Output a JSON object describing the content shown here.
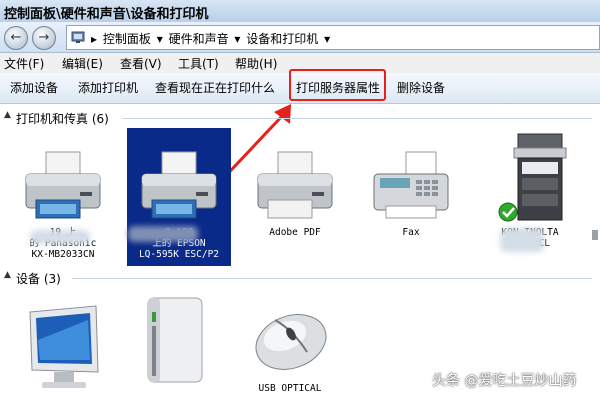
{
  "window": {
    "title": "控制面板\\硬件和声音\\设备和打印机"
  },
  "address": {
    "crumbs": [
      "控制面板",
      "硬件和声音",
      "设备和打印机"
    ]
  },
  "menu": {
    "items": [
      "文件(F)",
      "编辑(E)",
      "查看(V)",
      "工具(T)",
      "帮助(H)"
    ]
  },
  "toolbar": {
    "buttons": [
      "添加设备",
      "添加打印机",
      "查看现在正在打印什么",
      "打印服务器属性",
      "删除设备"
    ]
  },
  "groups": {
    "printers": {
      "label": "打印机和传真",
      "count": "(6)"
    },
    "devices": {
      "label": "设备",
      "count": "(3)"
    }
  },
  "printers": [
    {
      "line1": "19   上",
      "line2": "的 Panasonic",
      "line3": "KX-MB2033CN"
    },
    {
      "line1": "0.180",
      "line2": "上的 EPSON",
      "line3": "LQ-595K ESC/P2"
    },
    {
      "line1": "Adobe PDF",
      "line2": "",
      "line3": ""
    },
    {
      "line1": "Fax",
      "line2": "",
      "line3": ""
    },
    {
      "line1": "KON   INOLTA",
      "line2": "501/    CL",
      "line3": ""
    }
  ],
  "devices": [
    {
      "line1": "",
      "line2": ""
    },
    {
      "line1": "",
      "line2": ""
    },
    {
      "line1": "USB OPTICAL",
      "line2": ""
    }
  ],
  "watermark": "头条 @爱吃土豆炒山药",
  "colors": {
    "highlight": "#e4211b",
    "selection": "#0a2a8a"
  }
}
